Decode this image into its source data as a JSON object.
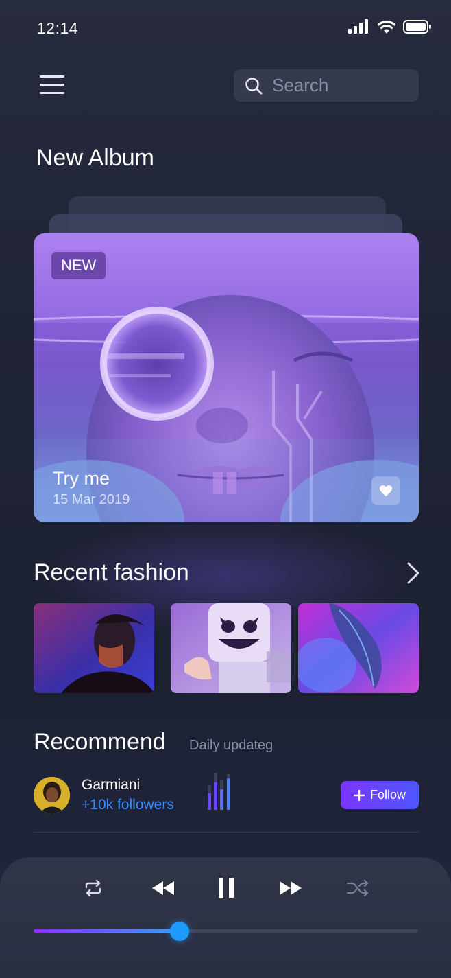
{
  "status_bar": {
    "time": "12:14"
  },
  "search": {
    "placeholder": "Search"
  },
  "new_album": {
    "section_title": "New Album",
    "badge": "NEW",
    "title": "Try me",
    "date": "15 Mar 2019"
  },
  "recent": {
    "section_title": "Recent fashion"
  },
  "recommend": {
    "section_title": "Recommend",
    "subtitle": "Daily updateg",
    "artist": {
      "name": "Garmiani",
      "followers": "+10k followers"
    },
    "follow_label": "Follow"
  },
  "player": {
    "progress": 0.38
  },
  "colors": {
    "accent_purple": "#7a35ff",
    "accent_blue": "#3a8dff",
    "knob": "#1f9bff",
    "background": "#1e2334"
  },
  "icons": [
    "menu-icon",
    "search-icon",
    "heart-icon",
    "chevron-right-icon",
    "plus-icon",
    "repeat-icon",
    "rewind-icon",
    "pause-icon",
    "fast-forward-icon",
    "shuffle-icon"
  ]
}
